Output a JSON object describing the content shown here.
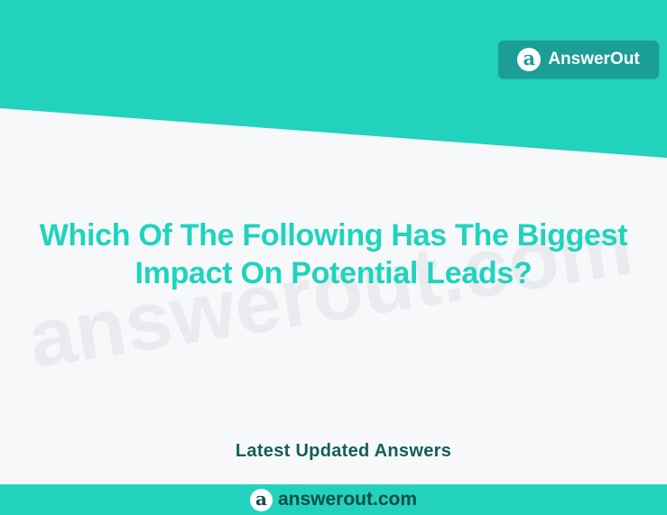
{
  "brand": {
    "badge_label": "AnswerOut",
    "logo_letter": "a"
  },
  "question": {
    "line1": "Which Of The Following Has The Biggest",
    "line2": "Impact On Potential Leads?"
  },
  "watermark": "answerout.com",
  "latest_updated": "Latest Updated Answers",
  "footer": {
    "site": "answerout.com"
  },
  "colors": {
    "teal": "#22d2bd",
    "badge_teal": "#1a9e96",
    "heading_teal": "#20d3bd",
    "dark_teal": "#125f59",
    "background": "#f7f8fa"
  }
}
